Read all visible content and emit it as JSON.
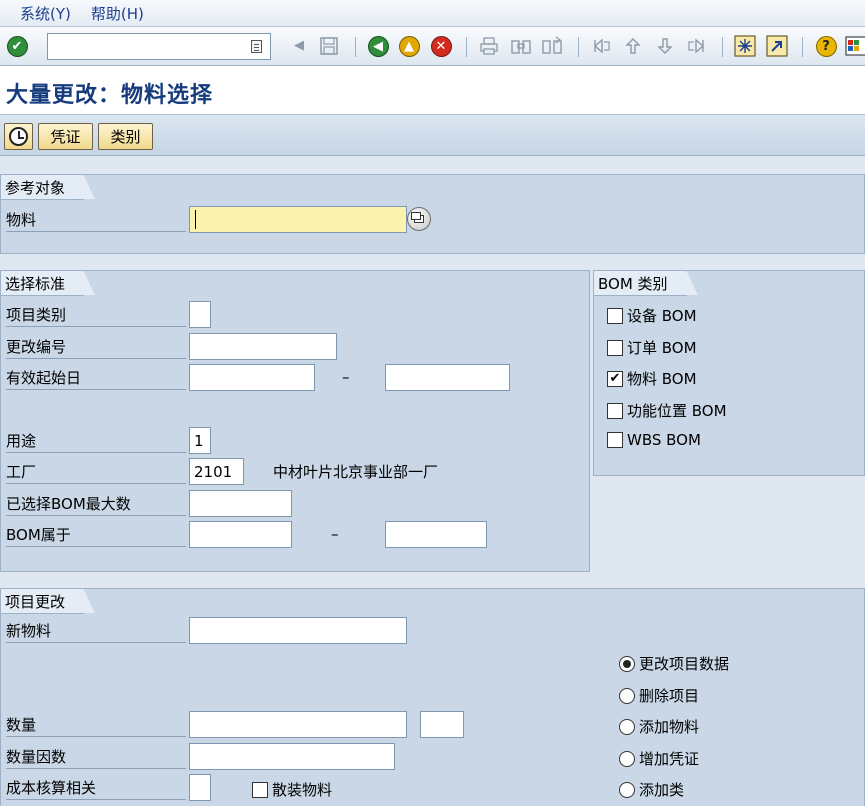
{
  "menu": {
    "items": [
      "系统(Y)",
      "帮助(H)"
    ]
  },
  "toolbar": {
    "command_value": ""
  },
  "title": "大量更改：物料选择",
  "app_toolbar": {
    "btn_voucher": "凭证",
    "btn_class": "类别"
  },
  "ref_group": {
    "title": "参考对象",
    "material_label": "物料",
    "material_value": ""
  },
  "sel_group": {
    "title": "选择标准",
    "item_category_label": "项目类别",
    "item_category_value": "",
    "change_number_label": "更改编号",
    "change_number_value": "",
    "valid_from_label": "有效起始日",
    "valid_from_value": "",
    "valid_to_value": "",
    "range_dash": "–",
    "usage_label": "用途",
    "usage_value": "1",
    "plant_label": "工厂",
    "plant_value": "2101",
    "plant_text": "中材叶片北京事业部一厂",
    "max_bom_label": "已选择BOM最大数",
    "max_bom_value": "",
    "bom_belongs_label": "BOM属于",
    "bom_from_value": "",
    "bom_to_value": "",
    "bom_dash": "–"
  },
  "bom_cat_group": {
    "title": "BOM 类别",
    "items": [
      {
        "label": "设备 BOM",
        "checked": false
      },
      {
        "label": "订单 BOM",
        "checked": false
      },
      {
        "label": "物料 BOM",
        "checked": true
      },
      {
        "label": "功能位置 BOM",
        "checked": false
      },
      {
        "label": "WBS BOM",
        "checked": false
      }
    ],
    "check_mark": "✔"
  },
  "item_change_group": {
    "title": "项目更改",
    "new_material_label": "新物料",
    "new_material_value": "",
    "quantity_label": "数量",
    "quantity_value": "",
    "unit_value": "",
    "qty_factor_label": "数量因数",
    "qty_factor_value": "",
    "costing_label": "成本核算相关",
    "costing_value": "",
    "bulk_label": "散装物料",
    "bulk_checked": false,
    "radios": [
      {
        "label": "更改项目数据",
        "selected": true
      },
      {
        "label": "删除项目",
        "selected": false
      },
      {
        "label": "添加物料",
        "selected": false
      },
      {
        "label": "增加凭证",
        "selected": false
      },
      {
        "label": "添加类",
        "selected": false
      }
    ]
  },
  "colors": {
    "title_text": "#173c7d",
    "required_field": "#fbf2b0",
    "group_bg": "#c9d7e6",
    "button_bg": "#f1d98c"
  }
}
